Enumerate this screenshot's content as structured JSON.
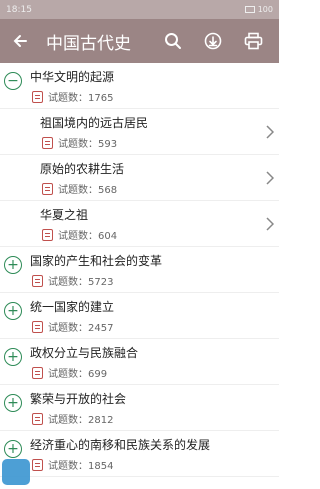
{
  "status": {
    "time": "18:15",
    "battery": "100"
  },
  "appbar": {
    "title": "中国古代史"
  },
  "icons": {
    "back": "arrow-left-icon",
    "search": "search-icon",
    "download": "download-icon",
    "print": "print-icon",
    "doc": "document-icon",
    "chevron": "chevron-right-icon"
  },
  "colors": {
    "appbar": "#9b8585",
    "statusbar": "#b8a8a8",
    "toggle": "#2e8b57",
    "doc_icon": "#c0504d"
  },
  "list": [
    {
      "type": "parent",
      "expanded": true,
      "title": "中华文明的起源",
      "count": "试题数：1765"
    },
    {
      "type": "child",
      "title": "祖国境内的远古居民",
      "count": "试题数：593"
    },
    {
      "type": "child",
      "title": "原始的农耕生活",
      "count": "试题数：568"
    },
    {
      "type": "child",
      "title": "华夏之祖",
      "count": "试题数：604"
    },
    {
      "type": "parent",
      "expanded": false,
      "title": "国家的产生和社会的变革",
      "count": "试题数：5723"
    },
    {
      "type": "parent",
      "expanded": false,
      "title": "统一国家的建立",
      "count": "试题数：2457"
    },
    {
      "type": "parent",
      "expanded": false,
      "title": "政权分立与民族融合",
      "count": "试题数：699"
    },
    {
      "type": "parent",
      "expanded": false,
      "title": "繁荣与开放的社会",
      "count": "试题数：2812"
    },
    {
      "type": "parent",
      "expanded": false,
      "title": "经济重心的南移和民族关系的发展",
      "count": "试题数：1854"
    }
  ]
}
